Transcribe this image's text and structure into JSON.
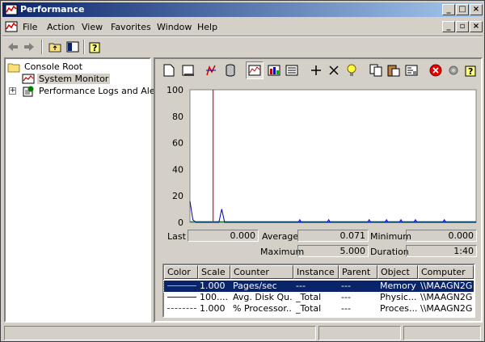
{
  "window": {
    "title": "Performance",
    "icon": "performance-app-icon"
  },
  "menu": {
    "items": [
      "File",
      "Action",
      "View",
      "Favorites",
      "Window",
      "Help"
    ]
  },
  "tree": {
    "root": "Console Root",
    "children": [
      "System Monitor",
      "Performance Logs and Alerts"
    ]
  },
  "graph": {
    "y_ticks": [
      "100",
      "80",
      "60",
      "40",
      "20",
      "0"
    ],
    "y_range": [
      0,
      100
    ],
    "colors": {
      "pages": "#0000c0",
      "disk": "#0000ff",
      "processor": "#008000",
      "cursor": "#ff0000",
      "bg": "#ffffff"
    },
    "series_pages_sec": [
      16,
      2,
      0,
      0,
      0,
      0,
      0,
      0,
      0,
      0,
      0,
      10,
      0,
      0,
      0,
      0,
      0,
      0,
      0,
      0,
      0,
      0,
      0,
      0,
      0,
      0,
      0,
      0,
      0,
      0,
      0,
      0,
      0,
      0,
      0,
      0,
      0,
      0,
      0,
      0,
      0,
      0,
      0,
      0,
      0,
      0,
      0,
      0,
      0,
      0,
      0,
      0,
      0,
      0,
      0,
      0,
      0,
      0,
      0,
      0,
      0,
      0,
      0,
      0,
      0,
      0,
      0,
      0,
      0,
      0,
      0,
      0,
      0,
      0,
      0,
      0,
      0,
      0,
      0,
      0,
      0,
      0,
      0,
      0,
      0,
      0,
      0,
      0,
      0,
      0,
      0,
      0,
      0,
      0,
      0,
      0,
      0,
      0,
      0,
      0
    ]
  },
  "stats": {
    "last_label": "Last",
    "last_value": "0.000",
    "average_label": "Average",
    "average_value": "0.071",
    "minimum_label": "Minimum",
    "minimum_value": "0.000",
    "maximum_label": "Maximum",
    "maximum_value": "5.000",
    "duration_label": "Duration",
    "duration_value": "1:40"
  },
  "legend": {
    "columns": [
      "Color",
      "Scale",
      "Counter",
      "Instance",
      "Parent",
      "Object",
      "Computer"
    ],
    "rows": [
      {
        "color": "#c0c000",
        "scale": "1.000",
        "counter": "Pages/sec",
        "instance": "---",
        "parent": "---",
        "object": "Memory",
        "computer": "\\\\MAAGN2G..."
      },
      {
        "color": "#0000ff",
        "scale": "100....",
        "counter": "Avg. Disk Qu...",
        "instance": "_Total",
        "parent": "---",
        "object": "Physic...",
        "computer": "\\\\MAAGN2G..."
      },
      {
        "color": "#008000",
        "scale": "1.000",
        "counter": "% Processor...",
        "instance": "_Total",
        "parent": "---",
        "object": "Proces...",
        "computer": "\\\\MAAGN2G..."
      }
    ]
  }
}
